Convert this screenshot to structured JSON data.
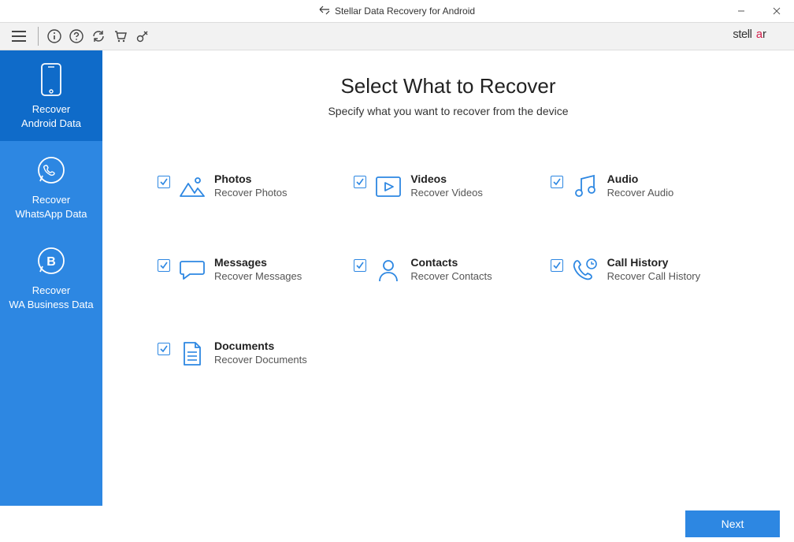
{
  "window": {
    "title": "Stellar Data Recovery for Android"
  },
  "brand": "stellar",
  "sidebar": {
    "items": [
      {
        "label": "Recover\nAndroid Data"
      },
      {
        "label": "Recover\nWhatsApp Data"
      },
      {
        "label": "Recover\nWA Business Data"
      }
    ]
  },
  "page": {
    "heading": "Select What to Recover",
    "subheading": "Specify what you want to recover from the device"
  },
  "options": [
    {
      "title": "Photos",
      "sub": "Recover Photos"
    },
    {
      "title": "Videos",
      "sub": "Recover Videos"
    },
    {
      "title": "Audio",
      "sub": "Recover Audio"
    },
    {
      "title": "Messages",
      "sub": "Recover Messages"
    },
    {
      "title": "Contacts",
      "sub": "Recover Contacts"
    },
    {
      "title": "Call History",
      "sub": "Recover Call History"
    },
    {
      "title": "Documents",
      "sub": "Recover Documents"
    }
  ],
  "footer": {
    "next": "Next"
  }
}
